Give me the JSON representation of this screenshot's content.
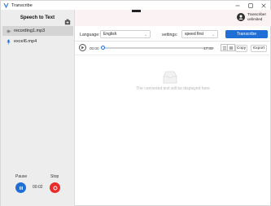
{
  "window": {
    "title": "Transcribe"
  },
  "sidebar": {
    "title": "Speech to Text",
    "files": [
      {
        "name": "recording1.mp3",
        "icon": "waveform-icon",
        "active": true
      },
      {
        "name": "excel6.mp4",
        "icon": "microphone-icon",
        "active": false
      }
    ],
    "recorder": {
      "pause_label": "Pause",
      "stop_label": "Stop",
      "elapsed": "00:02"
    }
  },
  "header": {
    "user_name": "Transcriber",
    "user_plan": "unlimited"
  },
  "settings": {
    "language_label": "Language:",
    "language_value": "English",
    "settings_label": "settings:",
    "settings_value": "speed first",
    "transcribe_label": "Transcribe"
  },
  "player": {
    "current_time": "00:00",
    "total_time": "17:33",
    "copy_label": "Copy",
    "export_label": "Export"
  },
  "content": {
    "empty_message": "The converted text will be displayed here"
  },
  "colors": {
    "accent": "#1f6fd6",
    "stop": "#ea2b2b",
    "sidebar_bg": "#ededed",
    "header_bg": "#fbf3f3"
  }
}
